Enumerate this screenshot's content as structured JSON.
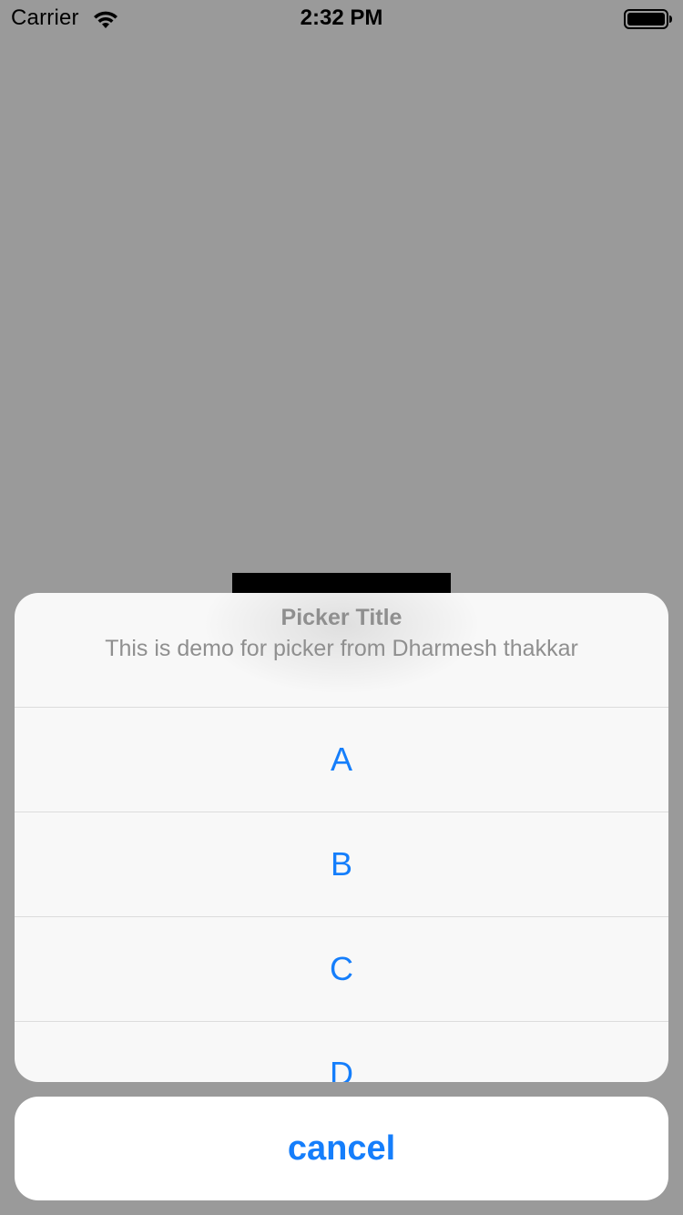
{
  "status_bar": {
    "carrier": "Carrier",
    "time": "2:32 PM",
    "wifi_icon": "wifi-icon",
    "battery_icon": "battery-icon"
  },
  "picker": {
    "title": "Picker Title",
    "message": "This is demo for picker from Dharmesh thakkar",
    "options": [
      {
        "label": "A"
      },
      {
        "label": "B"
      },
      {
        "label": "C"
      },
      {
        "label": "D"
      }
    ]
  },
  "cancel": {
    "label": "cancel"
  },
  "colors": {
    "background": "#9a9a9a",
    "sheet": "#f8f8f8",
    "accent": "#157efb",
    "muted_text": "#8f8f8f",
    "separator": "#dcdcdc"
  }
}
